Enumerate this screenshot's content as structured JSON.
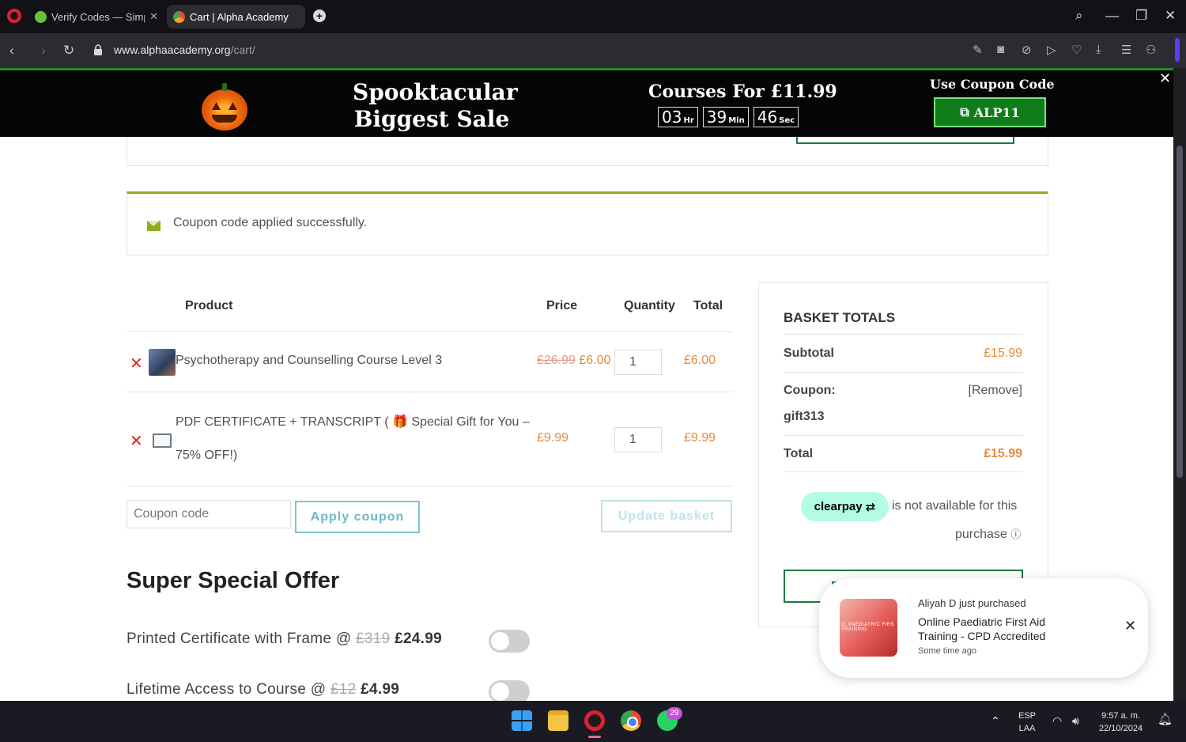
{
  "browser": {
    "tabs": [
      {
        "title": "Verify Codes — SimplyC",
        "active": false
      },
      {
        "title": "Cart | Alpha Academy",
        "active": true
      }
    ],
    "url_host": "www.alphaacademy.org",
    "url_path": "/cart/"
  },
  "promo": {
    "title_line1": "Spooktacular",
    "title_line2": "Biggest Sale",
    "courses_for": "Courses For £11.99",
    "timer": {
      "hours": "03",
      "hours_unit": "Hr",
      "minutes": "39",
      "minutes_unit": "Min",
      "seconds": "46",
      "seconds_unit": "Sec"
    },
    "use_coupon_label": "Use Coupon Code",
    "coupon_code": "ALP11"
  },
  "notice": {
    "message": "Coupon code applied successfully."
  },
  "cart": {
    "headers": {
      "product": "Product",
      "price": "Price",
      "quantity": "Quantity",
      "total": "Total"
    },
    "items": [
      {
        "name": "Psychotherapy and Counselling Course Level 3",
        "old_price": "£26.99",
        "price": "£6.00",
        "qty": "1",
        "total": "£6.00"
      },
      {
        "name_line1": "PDF CERTIFICATE + TRANSCRIPT ( 🎁 Special Gift for You –",
        "name_line2": "75% OFF!)",
        "price": "£9.99",
        "qty": "1",
        "total": "£9.99"
      }
    ],
    "coupon_placeholder": "Coupon code",
    "apply_label": "Apply coupon",
    "update_label": "Update basket"
  },
  "offers": {
    "title": "Super Special Offer",
    "items": [
      {
        "label": "Printed Certificate with Frame @",
        "old": "£319",
        "price": "£24.99",
        "enabled": false
      },
      {
        "label": "Lifetime Access to Course @",
        "old": "£12",
        "price": "£4.99",
        "enabled": false
      }
    ]
  },
  "totals": {
    "heading": "BASKET TOTALS",
    "subtotal_label": "Subtotal",
    "subtotal": "£15.99",
    "coupon_label": "Coupon:",
    "coupon_code": "gift313",
    "remove_label": "[Remove]",
    "total_label": "Total",
    "total": "£15.99",
    "clearpay_brand": "clearpay",
    "clearpay_text": "is not available for this",
    "clearpay_text2": "purchase",
    "proceed_partial": "Pr"
  },
  "popup": {
    "who": "Aliyah D just purchased",
    "what": "Online Paediatric First Aid Training - CPD Accredited",
    "when": "Some time ago",
    "image_text": "IC PAEDIATRIC FIRS TRAINING"
  },
  "taskbar": {
    "whatsapp_badge": "29",
    "lang1": "ESP",
    "lang2": "LAA",
    "time": "9:57 a. m.",
    "date": "22/10/2024"
  },
  "colors": {
    "accent_orange": "#e68a3c",
    "promo_green": "#0e7d1a",
    "success_bar": "#8fae1b",
    "remove_red": "#e2231a"
  }
}
